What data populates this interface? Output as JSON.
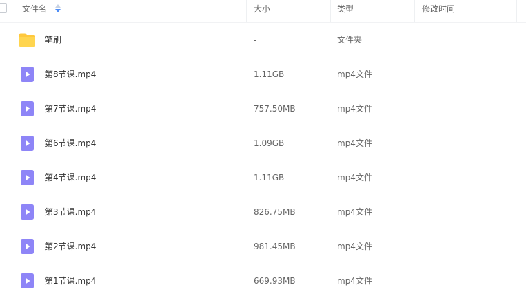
{
  "header": {
    "name_label": "文件名",
    "size_label": "大小",
    "type_label": "类型",
    "time_label": "修改时间"
  },
  "colors": {
    "folder": "#ffc83d",
    "video": "#8e85f7",
    "sort_active": "#4d8df7"
  },
  "rows": [
    {
      "icon": "folder-icon",
      "name": "笔刷",
      "size": "-",
      "type": "文件夹"
    },
    {
      "icon": "video-file-icon",
      "name": "第8节课.mp4",
      "size": "1.11GB",
      "type": "mp4文件"
    },
    {
      "icon": "video-file-icon",
      "name": "第7节课.mp4",
      "size": "757.50MB",
      "type": "mp4文件"
    },
    {
      "icon": "video-file-icon",
      "name": "第6节课.mp4",
      "size": "1.09GB",
      "type": "mp4文件"
    },
    {
      "icon": "video-file-icon",
      "name": "第4节课.mp4",
      "size": "1.11GB",
      "type": "mp4文件"
    },
    {
      "icon": "video-file-icon",
      "name": "第3节课.mp4",
      "size": "826.75MB",
      "type": "mp4文件"
    },
    {
      "icon": "video-file-icon",
      "name": "第2节课.mp4",
      "size": "981.45MB",
      "type": "mp4文件"
    },
    {
      "icon": "video-file-icon",
      "name": "第1节课.mp4",
      "size": "669.93MB",
      "type": "mp4文件"
    }
  ]
}
